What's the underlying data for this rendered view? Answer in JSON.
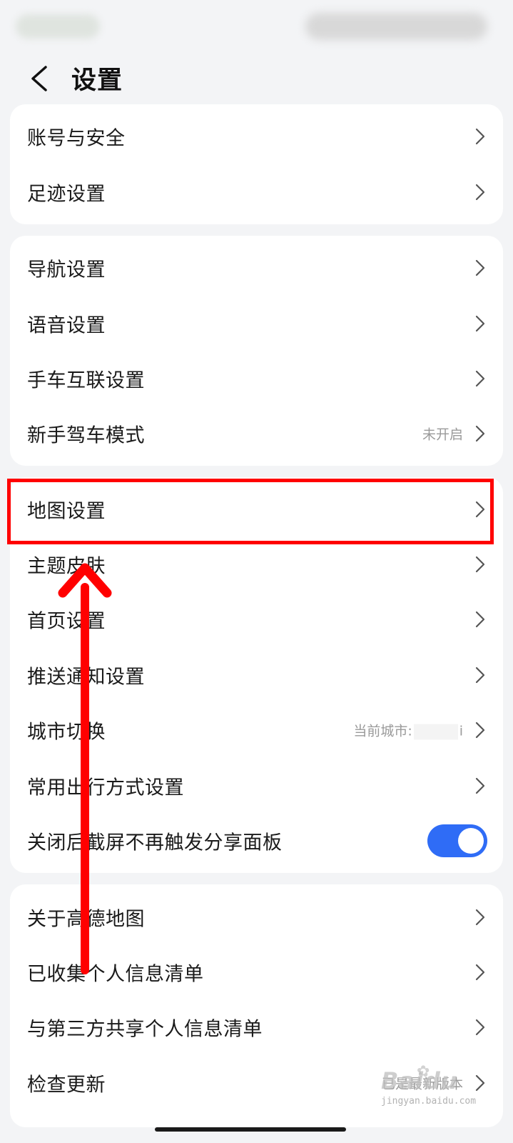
{
  "header": {
    "title": "设置"
  },
  "group1": [
    {
      "label": "账号与安全"
    },
    {
      "label": "足迹设置"
    }
  ],
  "group2": [
    {
      "label": "导航设置"
    },
    {
      "label": "语音设置"
    },
    {
      "label": "手车互联设置"
    },
    {
      "label": "新手驾车模式",
      "value": "未开启"
    }
  ],
  "group3": [
    {
      "label": "地图设置"
    },
    {
      "label": "主题皮肤"
    },
    {
      "label": "首页设置"
    },
    {
      "label": "推送通知设置"
    },
    {
      "label": "城市切换",
      "value_prefix": "当前城市:",
      "value_suffix": "i"
    },
    {
      "label": "常用出行方式设置"
    },
    {
      "label": "关闭后截屏不再触发分享面板",
      "toggle_on": true
    }
  ],
  "group4": [
    {
      "label": "关于高德地图"
    },
    {
      "label": "已收集个人信息清单"
    },
    {
      "label": "与第三方共享个人信息清单"
    },
    {
      "label": "检查更新",
      "value": "已是最新版本"
    }
  ],
  "watermark": {
    "main": "Baidu",
    "sub": "jingyan.baidu.com"
  },
  "colors": {
    "accent": "#2f6cf6",
    "highlight": "#ff0000",
    "background": "#f3f4f6"
  }
}
